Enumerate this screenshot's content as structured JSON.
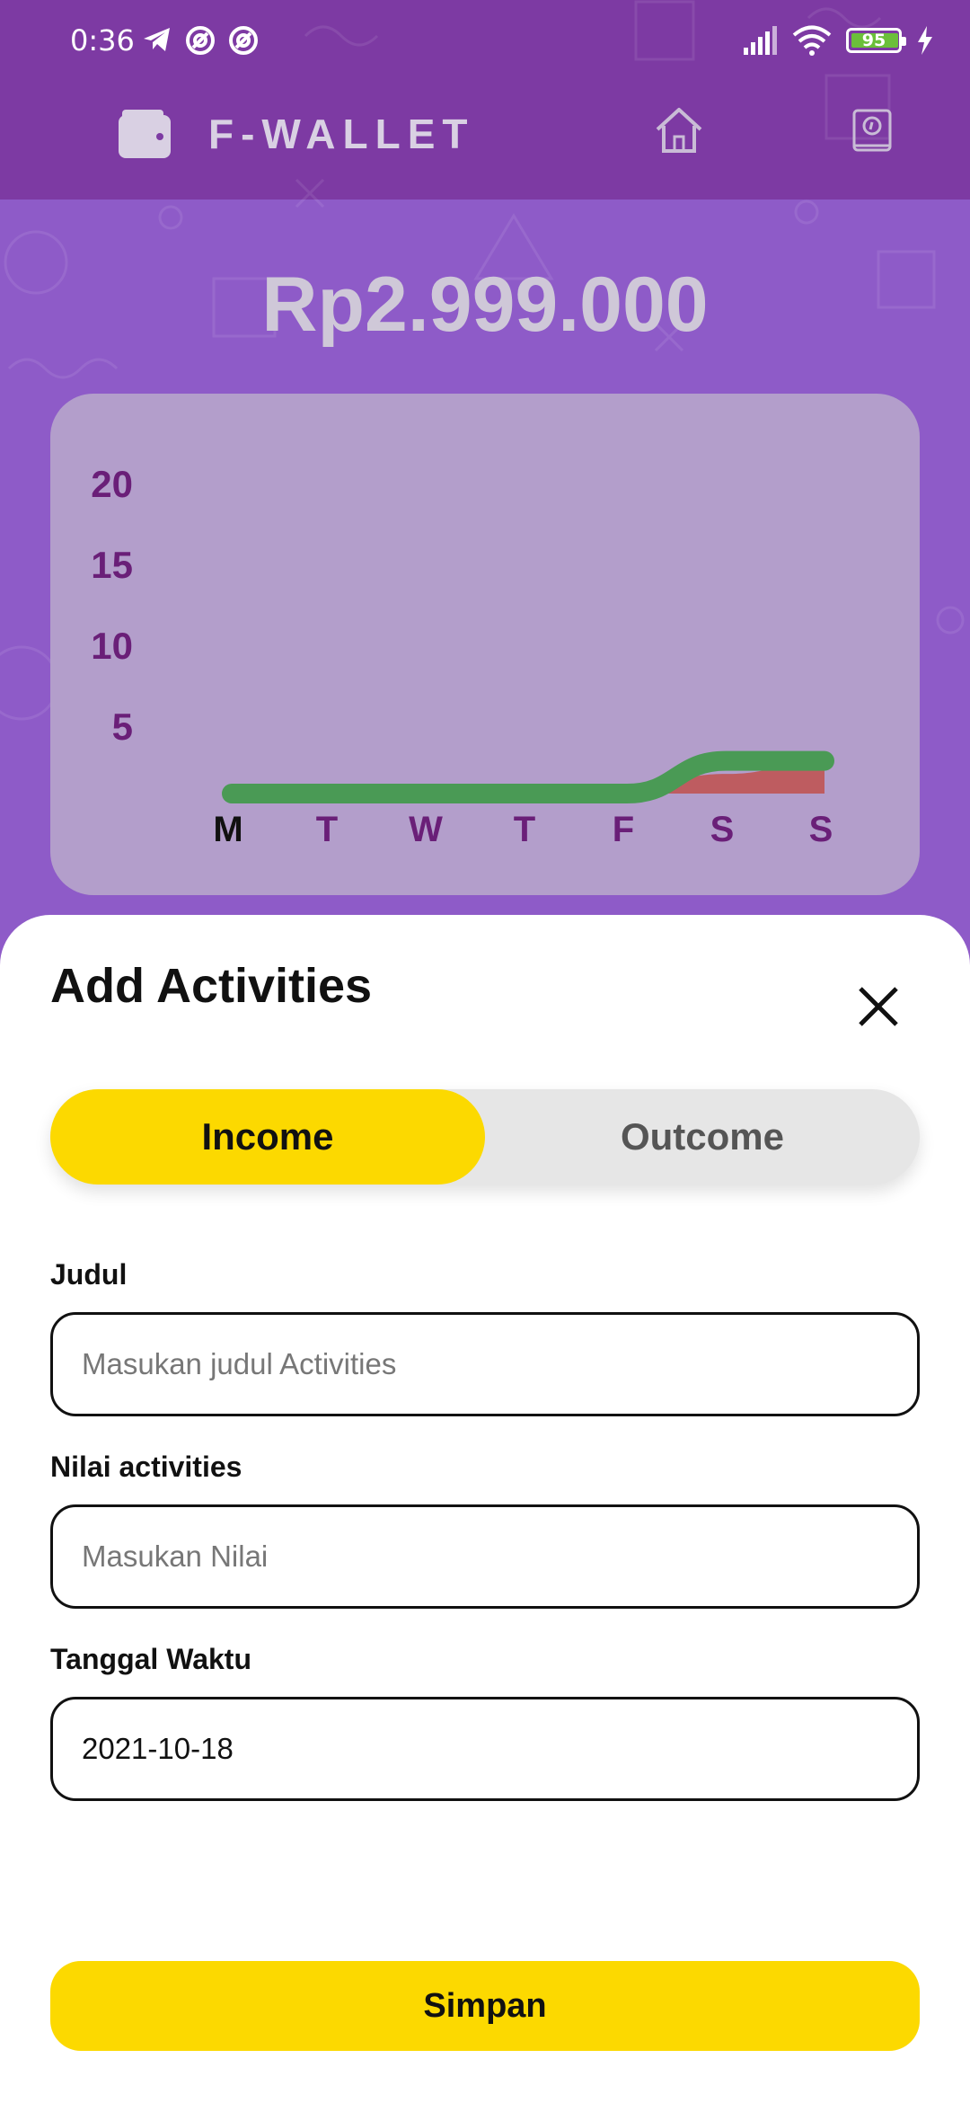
{
  "status_bar": {
    "time": "0:36",
    "battery": "95"
  },
  "app": {
    "title": "F-WALLET"
  },
  "balance": "Rp2.999.000",
  "chart_data": {
    "type": "area",
    "categories": [
      "M",
      "T",
      "W",
      "T",
      "F",
      "S",
      "S"
    ],
    "ytick_labels": [
      "20",
      "15",
      "10",
      "5"
    ],
    "yticks": [
      20,
      15,
      10,
      5
    ],
    "ylim": [
      0,
      22
    ],
    "series": [
      {
        "color": "#4a9a55",
        "values": [
          0,
          0,
          0,
          0,
          0,
          2,
          2
        ]
      },
      {
        "color": "#c0504d",
        "values": [
          0,
          0,
          0,
          0,
          0.3,
          1.2,
          2
        ]
      }
    ]
  },
  "sheet": {
    "title": "Add Activities",
    "toggle": {
      "income": "Income",
      "outcome": "Outcome",
      "selected": "Income"
    },
    "fields": [
      {
        "label": "Judul",
        "placeholder": "Masukan judul Activities",
        "value": ""
      },
      {
        "label": "Nilai activities",
        "placeholder": "Masukan Nilai",
        "value": ""
      },
      {
        "label": "Tanggal Waktu",
        "placeholder": "",
        "value": "2021-10-18"
      }
    ],
    "save_label": "Simpan"
  },
  "colors": {
    "header": "#7d3aa3",
    "background": "#8e5bc8",
    "accent": "#fcd900",
    "axis_label": "#6a1f78",
    "income_line": "#4a9a55",
    "outcome_area": "#c0504d"
  },
  "icons": [
    "telegram-icon",
    "notification-icon",
    "signal-icon",
    "wifi-icon",
    "battery-icon",
    "charging-icon",
    "wallet-icon",
    "home-icon",
    "book-icon",
    "close-icon"
  ]
}
